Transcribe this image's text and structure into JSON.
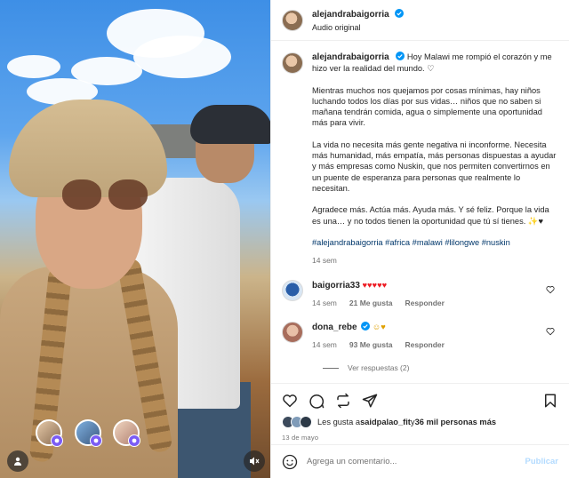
{
  "header": {
    "username": "alejandrabaigorria",
    "audio": "Audio original",
    "more_icon": "more-horizontal-icon"
  },
  "caption": {
    "username": "alejandrabaigorria",
    "p1": "Hoy Malawi me rompió el corazón y me hizo ver la realidad del mundo. ♡",
    "p2": "Mientras muchos nos quejamos por cosas mínimas, hay niños luchando todos los días por sus vidas… niños que no saben si mañana tendrán comida, agua o simplemente una oportunidad más para vivir.",
    "p3": "La vida no necesita más gente negativa ni inconforme. Necesita más humanidad, más empatía, más personas dispuestas a ayudar y más empresas como Nuskin, que nos permiten convertirnos en un puente de esperanza para personas que realmente lo necesitan.",
    "p4": "Agradece más. Actúa más. Ayuda más. Y sé feliz. Porque la vida es una… y no todos tienen la oportunidad que tú sí tienes. ✨♥",
    "hashtags": "#alejandrabaigorria #africa #malawi #lilongwe #nuskin",
    "time": "14 sem"
  },
  "comments": [
    {
      "username": "baigorria33",
      "text": "♥♥♥♥♥",
      "time": "14 sem",
      "likes": "21 Me gusta",
      "reply": "Responder"
    },
    {
      "username": "dona_rebe",
      "text": "☺♥",
      "time": "14 sem",
      "likes": "93 Me gusta",
      "reply": "Responder"
    }
  ],
  "view_replies": "Ver respuestas (2)",
  "actions": {
    "icons": [
      "heart-icon",
      "comment-icon",
      "repost-icon",
      "share-icon",
      "bookmark-icon"
    ]
  },
  "likes": {
    "prefix": "Les gusta a ",
    "user": "saidpalao_fit",
    "middle": " y ",
    "others": "36 mil personas más"
  },
  "date": "13 de mayo",
  "add_comment": {
    "placeholder": "Agrega un comentario...",
    "publish": "Publicar"
  },
  "colors": {
    "verified": "#0095f6",
    "link": "#00376b",
    "publish_disabled": "#b3dbff",
    "badge_purple": "#7b5cf5"
  }
}
